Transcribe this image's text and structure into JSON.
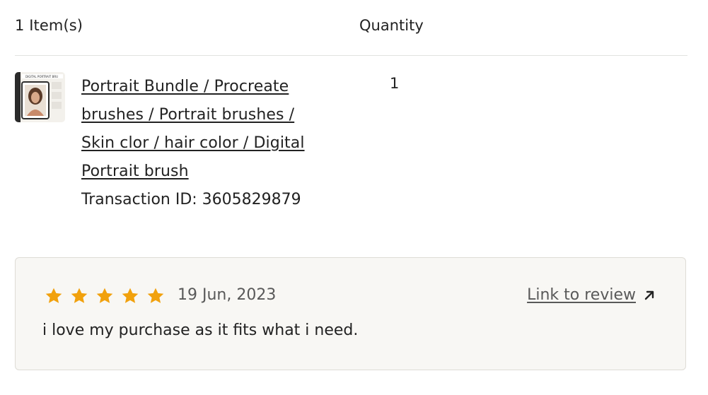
{
  "header": {
    "items_label": "1 Item(s)",
    "quantity_label": "Quantity"
  },
  "item": {
    "title_lines": [
      "Portrait Bundle / Procreate",
      "brushes / Portrait brushes /",
      "Skin clor / hair color / Digital",
      "Portrait brush"
    ],
    "transaction_label": "Transaction ID: 3605829879",
    "quantity": "1",
    "thumbnail_icon": "product-thumbnail",
    "thumbnail_banner_text": "DIGITAL PORTRAIT BRU"
  },
  "review": {
    "rating": 5,
    "rating_max": 5,
    "star_color": "#f1a10d",
    "date": "19 Jun, 2023",
    "link_label": "Link to review",
    "link_icon": "arrow-up-right-icon",
    "text": "i love my purchase as it fits what i need."
  }
}
